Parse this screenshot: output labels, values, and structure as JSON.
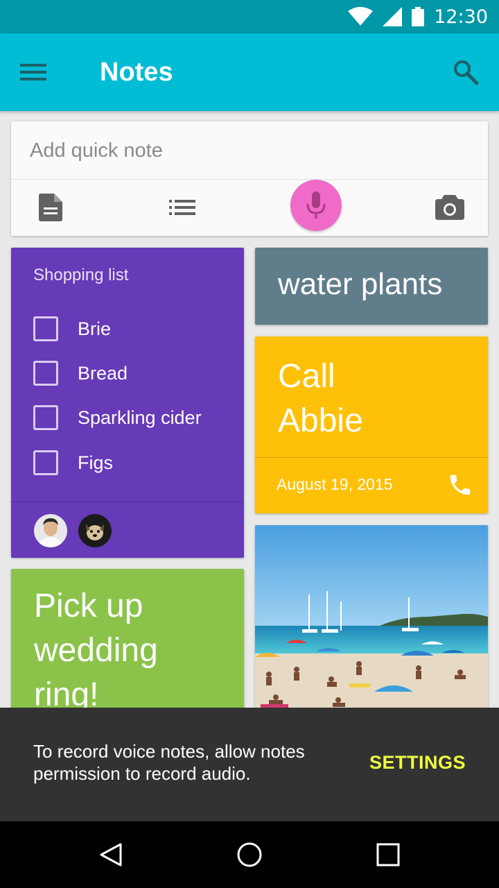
{
  "status_bar": {
    "time": "12:30",
    "icons": [
      "wifi-icon",
      "cellular-signal-icon",
      "battery-icon"
    ]
  },
  "app_bar": {
    "title": "Notes",
    "icons": [
      "menu-icon",
      "search-icon"
    ],
    "color": "#00bcd4"
  },
  "quick_note": {
    "placeholder": "Add quick note",
    "actions": [
      "text-note-icon",
      "list-icon",
      "mic-icon",
      "camera-icon"
    ],
    "mic_color": "#f06bc8"
  },
  "notes": {
    "shopping": {
      "title": "Shopping list",
      "items": [
        {
          "label": "Brie",
          "checked": false
        },
        {
          "label": "Bread",
          "checked": false
        },
        {
          "label": "Sparkling cider",
          "checked": false
        },
        {
          "label": "Figs",
          "checked": false
        }
      ],
      "collaborators": [
        "avatar-man",
        "avatar-dog"
      ],
      "color": "#673ab7"
    },
    "water": {
      "text": "water plants",
      "color": "#607d8b"
    },
    "call": {
      "line1": "Call",
      "line2": "Abbie",
      "date": "August 19, 2015",
      "color": "#ffc107"
    },
    "wedding": {
      "line1": "Pick up",
      "line2": "wedding",
      "line3": "ring!",
      "color": "#8bc34a"
    },
    "photo": {
      "subject": "beach-photo"
    }
  },
  "snackbar": {
    "message": "To record voice notes, allow notes permission to record audio.",
    "action": "SETTINGS",
    "action_color": "#eeff41"
  },
  "nav_bar": {
    "buttons": [
      "back-icon",
      "home-icon",
      "recents-icon"
    ]
  }
}
